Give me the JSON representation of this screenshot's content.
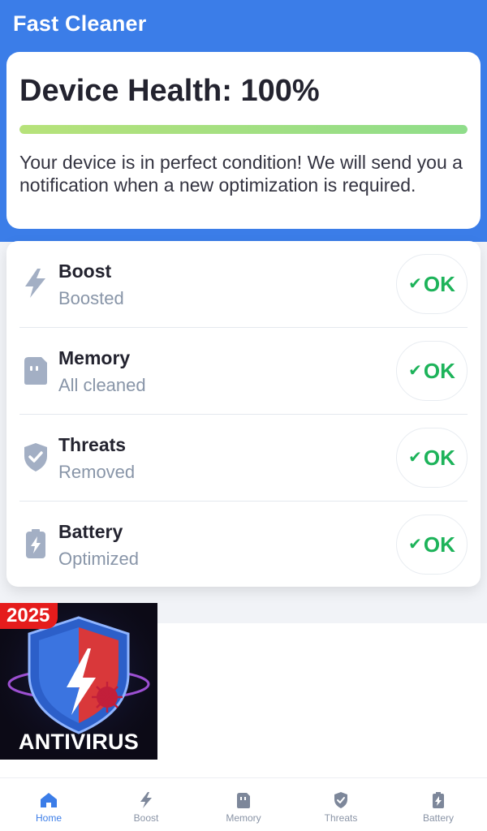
{
  "app": {
    "title": "Fast Cleaner"
  },
  "health": {
    "title": "Device Health: 100%",
    "progress": 1.0,
    "message": "Your device is in perfect condition! We will send you a notification when a new optimization is required."
  },
  "status_items": [
    {
      "icon": "lightning-icon",
      "title": "Boost",
      "subtitle": "Boosted",
      "status": "OK"
    },
    {
      "icon": "sd-card-icon",
      "title": "Memory",
      "subtitle": "All cleaned",
      "status": "OK"
    },
    {
      "icon": "shield-check-icon",
      "title": "Threats",
      "subtitle": "Removed",
      "status": "OK"
    },
    {
      "icon": "battery-charging-icon",
      "title": "Battery",
      "subtitle": "Optimized",
      "status": "OK"
    }
  ],
  "ad": {
    "badge": "2025",
    "label": "ANTIVIRUS"
  },
  "nav": {
    "active": "Home",
    "items": [
      {
        "label": "Home",
        "icon": "home-icon"
      },
      {
        "label": "Boost",
        "icon": "lightning-icon"
      },
      {
        "label": "Memory",
        "icon": "sd-card-icon"
      },
      {
        "label": "Threats",
        "icon": "shield-check-icon"
      },
      {
        "label": "Battery",
        "icon": "battery-charging-icon"
      }
    ]
  },
  "colors": {
    "primary": "#3b7de8",
    "ok_green": "#1db35a",
    "icon_gray": "#a3afc4",
    "nav_active": "#3b7de8",
    "nav_inactive": "#8a94a6",
    "progress_start": "#b7e27a",
    "progress_end": "#8fdd8a"
  }
}
